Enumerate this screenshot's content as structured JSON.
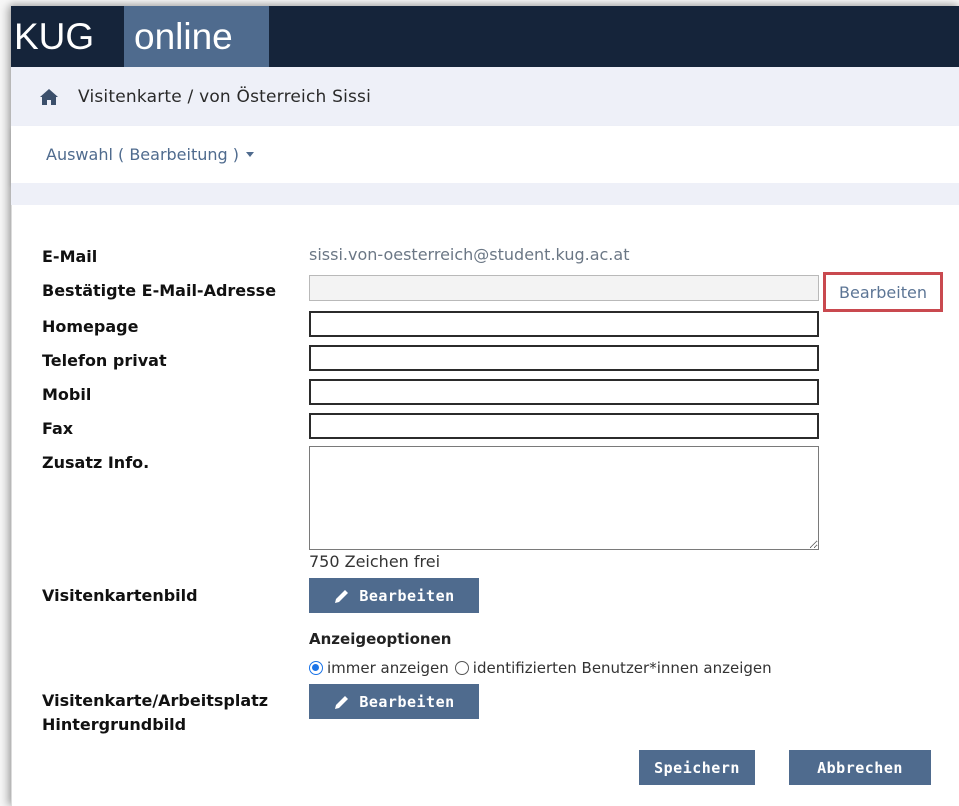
{
  "header": {
    "logo_kug": "KUG",
    "logo_online": "online"
  },
  "breadcrumb": {
    "text": "Visitenkarte  / von Österreich Sissi"
  },
  "subnav": {
    "label": "Auswahl ( Bearbeitung )"
  },
  "form": {
    "email": {
      "label": "E-Mail",
      "value": "sissi.von-oesterreich@student.kug.ac.at"
    },
    "confirmed_email": {
      "label": "Bestätigte E-Mail-Adresse",
      "value": "",
      "edit_label": "Bearbeiten"
    },
    "homepage": {
      "label": "Homepage",
      "value": ""
    },
    "phone_private": {
      "label": "Telefon privat",
      "value": ""
    },
    "mobile": {
      "label": "Mobil",
      "value": ""
    },
    "fax": {
      "label": "Fax",
      "value": ""
    },
    "additional_info": {
      "label": "Zusatz Info.",
      "value": "",
      "chars_free": "750 Zeichen frei"
    },
    "card_image": {
      "label": "Visitenkartenbild",
      "button": "Bearbeiten"
    },
    "display_options": {
      "title": "Anzeigeoptionen",
      "options": [
        "immer anzeigen",
        "identifizierten Benutzer*innen anzeigen"
      ],
      "selected": "immer anzeigen"
    },
    "background": {
      "label": "Visitenkarte/Arbeitsplatz Hintergrundbild",
      "button": "Bearbeiten"
    }
  },
  "actions": {
    "save": "Speichern",
    "cancel": "Abbrechen"
  },
  "colors": {
    "navy": "#15243a",
    "accent": "#4f6b8e",
    "highlight": "#c9494f"
  }
}
